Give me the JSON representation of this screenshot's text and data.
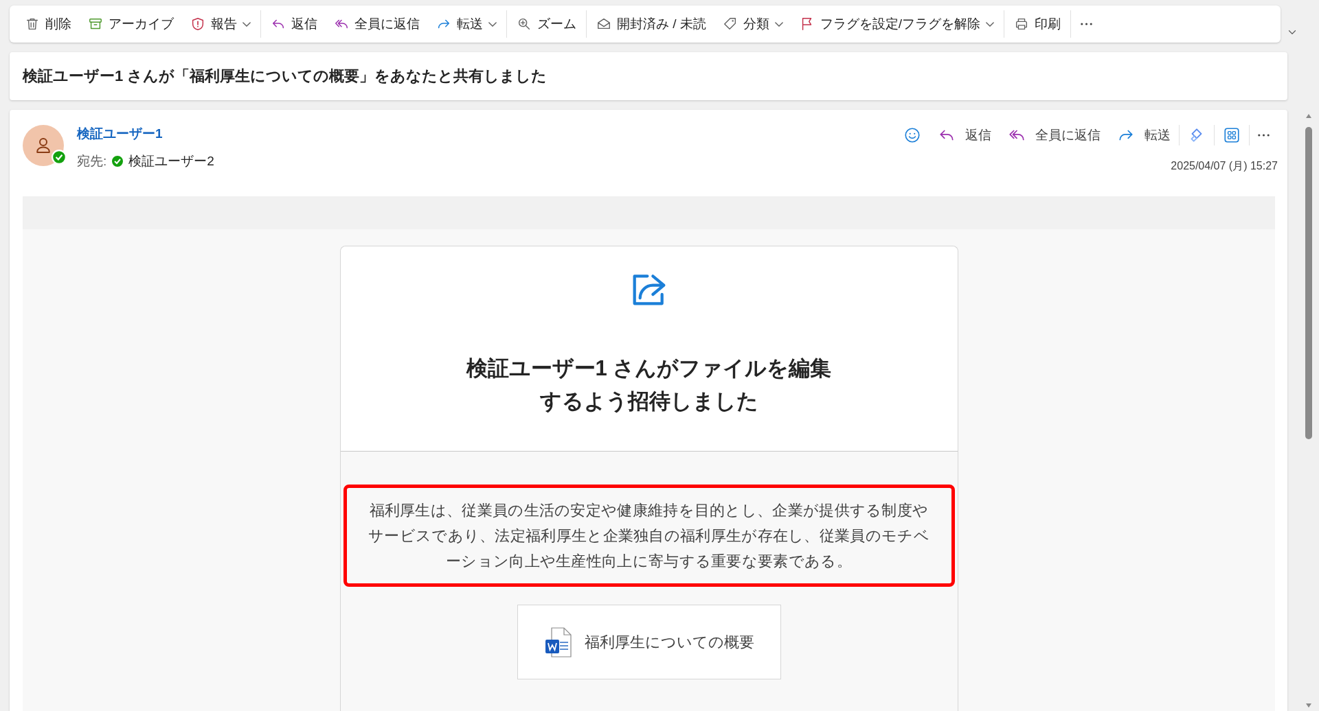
{
  "toolbar": {
    "items": [
      {
        "label": "削除",
        "kind": "trash",
        "dropdown": false,
        "separator_after": false
      },
      {
        "label": "アーカイブ",
        "kind": "archive",
        "dropdown": false,
        "separator_after": false
      },
      {
        "label": "報告",
        "kind": "shield",
        "dropdown": true,
        "separator_after": true
      },
      {
        "label": "返信",
        "kind": "reply",
        "dropdown": false,
        "separator_after": false
      },
      {
        "label": "全員に返信",
        "kind": "replyall",
        "dropdown": false,
        "separator_after": false
      },
      {
        "label": "転送",
        "kind": "forward",
        "dropdown": true,
        "separator_after": true
      },
      {
        "label": "ズーム",
        "kind": "zoom",
        "dropdown": false,
        "separator_after": true
      },
      {
        "label": "開封済み / 未読",
        "kind": "envelope",
        "dropdown": false,
        "separator_after": false
      },
      {
        "label": "分類",
        "kind": "tag",
        "dropdown": true,
        "separator_after": false
      },
      {
        "label": "フラグを設定/フラグを解除",
        "kind": "flag",
        "dropdown": true,
        "separator_after": true
      },
      {
        "label": "印刷",
        "kind": "printer",
        "dropdown": false,
        "separator_after": true
      },
      {
        "kind": "more",
        "dropdown": false,
        "separator_after": false
      }
    ]
  },
  "subject": "検証ユーザー1 さんが「福利厚生についての概要」をあなたと共有しました",
  "message": {
    "sender": "検証ユーザー1",
    "sender_online": true,
    "to_label": "宛先:",
    "recipient": "検証ユーザー2",
    "recipient_online": true,
    "actions": [
      {
        "kind": "emoji",
        "separator_after": false
      },
      {
        "label": "返信",
        "kind": "reply",
        "separator_after": false
      },
      {
        "label": "全員に返信",
        "kind": "replyall",
        "separator_after": false
      },
      {
        "label": "転送",
        "kind": "forward",
        "separator_after": true
      },
      {
        "kind": "copilot",
        "separator_after": true
      },
      {
        "kind": "apps",
        "separator_after": true
      },
      {
        "kind": "more",
        "separator_after": false
      }
    ],
    "date": "2025/04/07 (月) 15:27"
  },
  "share_card": {
    "title": "検証ユーザー1 さんがファイルを編集するよう招待しました",
    "message": "福利厚生は、従業員の生活の安定や健康維持を目的とし、企業が提供する制度やサービスであり、法定福利厚生と企業独自の福利厚生が存在し、従業員のモチベーション向上や生産性向上に寄与する重要な要素である。",
    "highlighted": true,
    "file": {
      "name": "福利厚生についての概要",
      "kind": "word"
    }
  }
}
